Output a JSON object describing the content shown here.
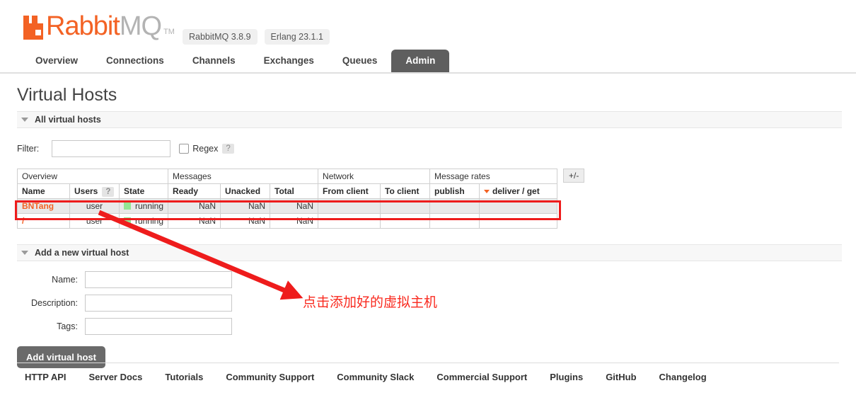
{
  "header": {
    "logo_rabbit": "Rabbit",
    "logo_mq": "MQ",
    "logo_tm": "TM",
    "badges": [
      {
        "label": "RabbitMQ 3.8.9"
      },
      {
        "label": "Erlang 23.1.1"
      }
    ]
  },
  "nav": {
    "tabs": [
      {
        "label": "Overview",
        "active": false
      },
      {
        "label": "Connections",
        "active": false
      },
      {
        "label": "Channels",
        "active": false
      },
      {
        "label": "Exchanges",
        "active": false
      },
      {
        "label": "Queues",
        "active": false
      },
      {
        "label": "Admin",
        "active": true
      }
    ]
  },
  "page": {
    "title": "Virtual Hosts"
  },
  "all_hosts": {
    "section_title": "All virtual hosts",
    "filter_label": "Filter:",
    "filter_value": "",
    "filter_placeholder": "",
    "regex_label": "Regex",
    "regex_checked": false,
    "help_badge": "?",
    "plus_minus": "+/-"
  },
  "table": {
    "group_headers": [
      {
        "label": "Overview",
        "span": 3
      },
      {
        "label": "Messages",
        "span": 3
      },
      {
        "label": "Network",
        "span": 2
      },
      {
        "label": "Message rates",
        "span": 2
      }
    ],
    "columns": [
      {
        "label": "Name",
        "align": "l"
      },
      {
        "label": "Users",
        "align": "c",
        "help": "?"
      },
      {
        "label": "State",
        "align": "l"
      },
      {
        "label": "Ready",
        "align": "r"
      },
      {
        "label": "Unacked",
        "align": "r"
      },
      {
        "label": "Total",
        "align": "r"
      },
      {
        "label": "From client",
        "align": "l"
      },
      {
        "label": "To client",
        "align": "l"
      },
      {
        "label": "publish",
        "align": "l"
      },
      {
        "label": "deliver / get",
        "align": "l",
        "sorted": "desc"
      }
    ],
    "rows": [
      {
        "name": "BNTang",
        "users": "user",
        "state": "running",
        "ready": "NaN",
        "unacked": "NaN",
        "total": "NaN",
        "from_client": "",
        "to_client": "",
        "publish": "",
        "deliver_get": ""
      },
      {
        "name": "/",
        "users": "user",
        "state": "running",
        "ready": "NaN",
        "unacked": "NaN",
        "total": "NaN",
        "from_client": "",
        "to_client": "",
        "publish": "",
        "deliver_get": ""
      }
    ]
  },
  "add_host": {
    "section_title": "Add a new virtual host",
    "fields": [
      {
        "label": "Name:",
        "value": "",
        "placeholder": ""
      },
      {
        "label": "Description:",
        "value": "",
        "placeholder": ""
      },
      {
        "label": "Tags:",
        "value": "",
        "placeholder": ""
      }
    ],
    "submit_label": "Add virtual host"
  },
  "footer": {
    "links": [
      {
        "label": "HTTP API"
      },
      {
        "label": "Server Docs"
      },
      {
        "label": "Tutorials"
      },
      {
        "label": "Community Support"
      },
      {
        "label": "Community Slack"
      },
      {
        "label": "Commercial Support"
      },
      {
        "label": "Plugins"
      },
      {
        "label": "GitHub"
      },
      {
        "label": "Changelog"
      }
    ]
  },
  "annotations": {
    "callout_text": "点击添加好的虚拟主机",
    "highlight_color": "#ee1c1c",
    "arrow_color": "#ee1c1c",
    "text_color": "#f92a1f"
  },
  "colors": {
    "brand_orange": "#f36224",
    "active_tab": "#5e5e5e",
    "status_running": "#93e693",
    "button_gray": "#6a6a6a"
  }
}
